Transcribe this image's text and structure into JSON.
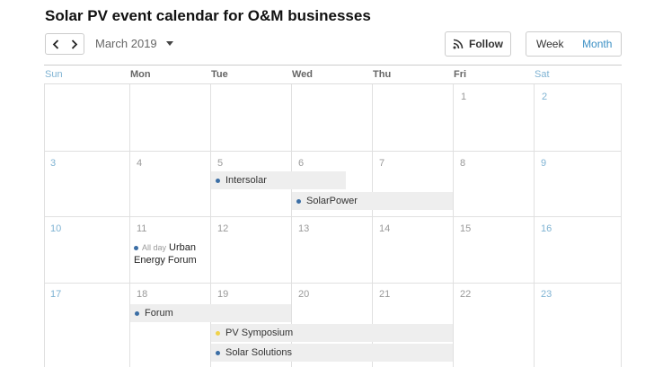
{
  "title": "Solar PV event calendar for O&M businesses",
  "toolbar": {
    "month_label": "March 2019",
    "follow_label": "Follow",
    "view_week": "Week",
    "view_month": "Month"
  },
  "colors": {
    "accent": "#3b8fc4",
    "event_dot": "#3b6ea5",
    "event_dot_alt": "#f0d24a",
    "weekend": "#7fb3d3"
  },
  "days_of_week": [
    "Sun",
    "Mon",
    "Tue",
    "Wed",
    "Thu",
    "Fri",
    "Sat"
  ],
  "weeks": [
    [
      "",
      "",
      "",
      "",
      "",
      "1",
      "2"
    ],
    [
      "3",
      "4",
      "5",
      "6",
      "7",
      "8",
      "9"
    ],
    [
      "10",
      "11",
      "12",
      "13",
      "14",
      "15",
      "16"
    ],
    [
      "17",
      "18",
      "19",
      "20",
      "21",
      "22",
      "23"
    ]
  ],
  "events": {
    "intersolar": "Intersolar",
    "solarpower": "SolarPower",
    "urban_tag": "All day",
    "urban_title": "Urban Energy Forum",
    "forum": "Forum",
    "pv_symposium": "PV Symposium",
    "solar_solutions": "Solar Solutions"
  }
}
